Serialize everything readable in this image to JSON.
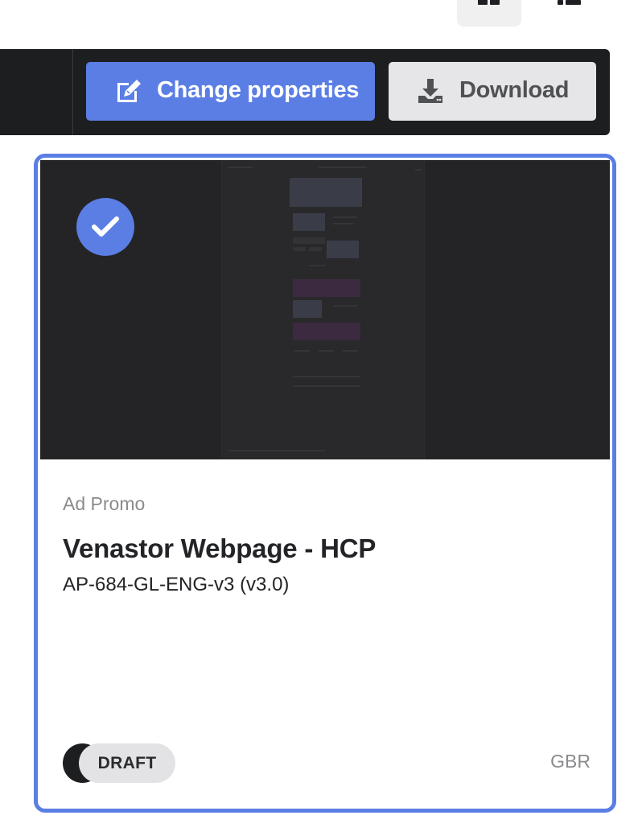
{
  "view_toggle": {
    "grid_icon": "grid-view-icon",
    "list_icon": "list-view-icon",
    "active": "grid"
  },
  "toolbar": {
    "change_properties_label": "Change properties",
    "change_properties_icon": "edit-icon",
    "download_label": "Download",
    "download_icon": "download-icon"
  },
  "card": {
    "selected": true,
    "selected_icon": "check-icon",
    "category": "Ad Promo",
    "title": "Venastor Webpage - HCP",
    "doc_id": "AP-684-GL-ENG-v3 (v3.0)",
    "status": "DRAFT",
    "region": "GBR"
  },
  "colors": {
    "accent": "#5b7ee5",
    "toolbar_bg": "#1d1e20",
    "secondary_btn": "#e6e6e8",
    "preview_bg": "#242426"
  }
}
